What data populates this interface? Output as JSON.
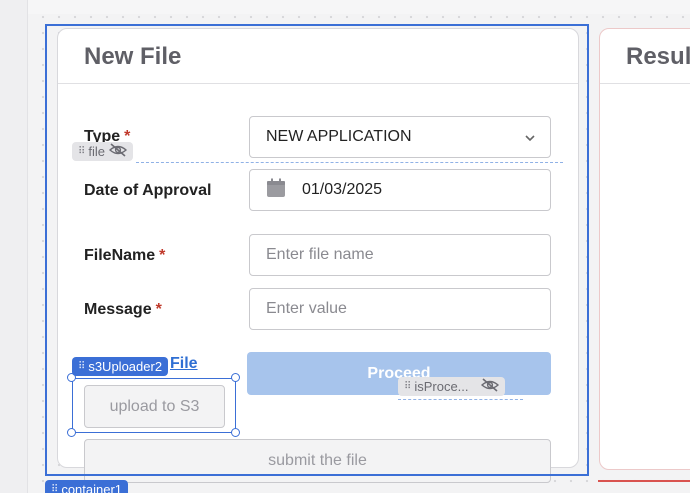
{
  "left_card": {
    "title": "New File",
    "type_label": "Type",
    "type_value": "NEW APPLICATION",
    "date_label": "Date of Approval",
    "date_value": "01/03/2025",
    "filename_label": "FileName",
    "filename_placeholder": "Enter file name",
    "message_label": "Message",
    "message_placeholder": "Enter value",
    "required_mark": "*",
    "proceed_label": "Proceed",
    "upload_label": "upload to S3",
    "submit_label": "submit the file",
    "partial_link": "File"
  },
  "right_card": {
    "title": "Resul"
  },
  "editor": {
    "file_tag": "file",
    "s3_tag": "s3Uploader2",
    "isproc_tag": "isProce...",
    "container_tag": "container1",
    "selection_color": "#3b6fd6"
  },
  "icons": [
    "grip-icon",
    "eye-off-icon",
    "calendar-icon",
    "chevron-down-icon"
  ]
}
